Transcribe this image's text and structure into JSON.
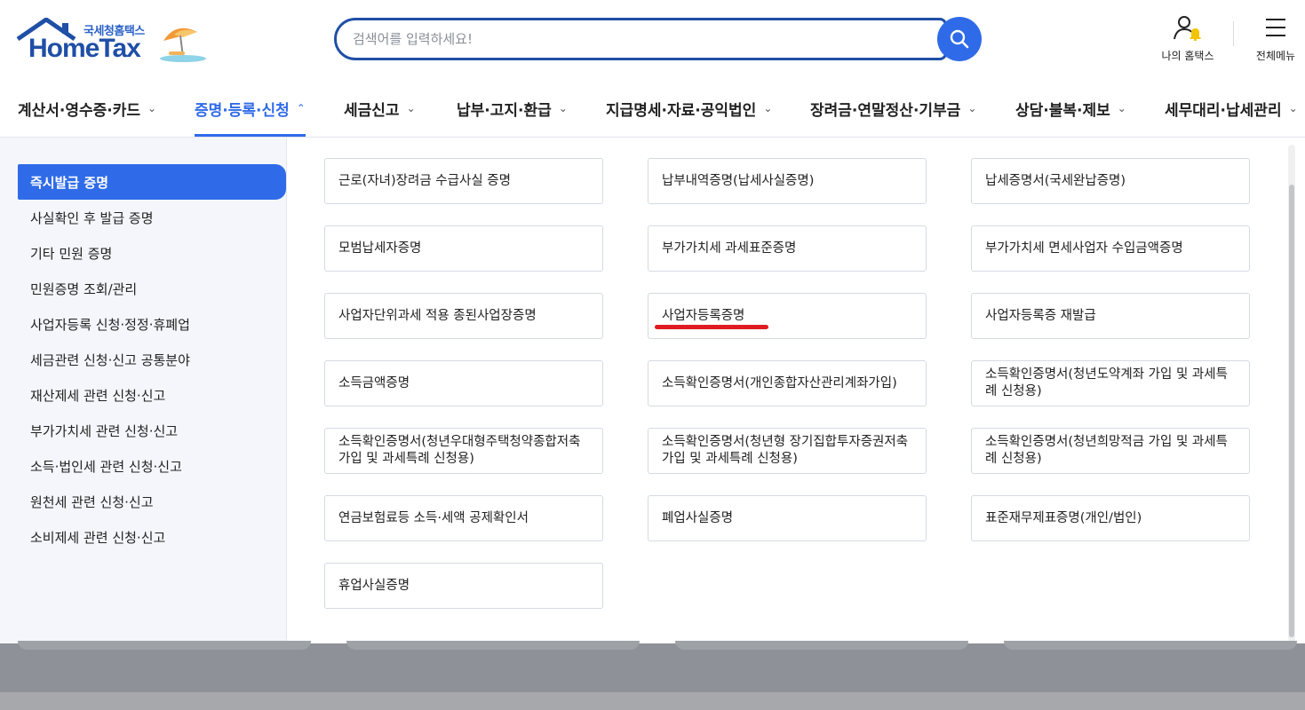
{
  "header": {
    "logo_top": "국세청홈택스",
    "logo_main": "HomeTax",
    "search_placeholder": "검색어를 입력하세요!",
    "my_hometax": "나의 홈택스",
    "all_menu": "전체메뉴"
  },
  "gnb": [
    {
      "label": "계산서·영수증·카드",
      "chev": "⌄"
    },
    {
      "label": "증명·등록·신청",
      "chev": "⌃"
    },
    {
      "label": "세금신고",
      "chev": "⌄"
    },
    {
      "label": "납부·고지·환급",
      "chev": "⌄"
    },
    {
      "label": "지급명세·자료·공익법인",
      "chev": "⌄"
    },
    {
      "label": "장려금·연말정산·기부금",
      "chev": "⌄"
    },
    {
      "label": "상담·불복·제보",
      "chev": "⌄"
    },
    {
      "label": "세무대리·납세관리",
      "chev": "⌄"
    }
  ],
  "lnb": [
    {
      "label": "즉시발급 증명"
    },
    {
      "label": "사실확인 후 발급 증명"
    },
    {
      "label": "기타 민원 증명"
    },
    {
      "label": "민원증명 조회/관리"
    },
    {
      "label": "사업자등록 신청·정정·휴폐업"
    },
    {
      "label": "세금관련 신청·신고 공통분야"
    },
    {
      "label": "재산제세 관련 신청·신고"
    },
    {
      "label": "부가가치세 관련 신청·신고"
    },
    {
      "label": "소득·법인세 관련 신청·신고"
    },
    {
      "label": "원천세 관련 신청·신고"
    },
    {
      "label": "소비제세 관련 신청·신고"
    }
  ],
  "cards": [
    {
      "label": "근로(자녀)장려금 수급사실 증명"
    },
    {
      "label": "납부내역증명(납세사실증명)"
    },
    {
      "label": "납세증명서(국세완납증명)"
    },
    {
      "label": "모범납세자증명"
    },
    {
      "label": "부가가치세 과세표준증명"
    },
    {
      "label": "부가가치세 면세사업자 수입금액증명"
    },
    {
      "label": "사업자단위과세 적용 종된사업장증명"
    },
    {
      "label": "사업자등록증명"
    },
    {
      "label": "사업자등록증 재발급"
    },
    {
      "label": "소득금액증명"
    },
    {
      "label": "소득확인증명서(개인종합자산관리계좌가입)"
    },
    {
      "label": "소득확인증명서(청년도약계좌 가입 및 과세특례 신청용)"
    },
    {
      "label": "소득확인증명서(청년우대형주택청약종합저축 가입 및 과세특례 신청용)"
    },
    {
      "label": "소득확인증명서(청년형 장기집합투자증권저축 가입 및 과세특례 신청용)"
    },
    {
      "label": "소득확인증명서(청년희망적금 가입 및 과세특례 신청용)"
    },
    {
      "label": "연금보험료등 소득·세액 공제확인서"
    },
    {
      "label": "폐업사실증명"
    },
    {
      "label": "표준재무제표증명(개인/법인)"
    },
    {
      "label": "휴업사실증명"
    }
  ],
  "colors": {
    "accent": "#2f6be8",
    "brand": "#1f4fa6",
    "highlight": "#e01c23"
  }
}
